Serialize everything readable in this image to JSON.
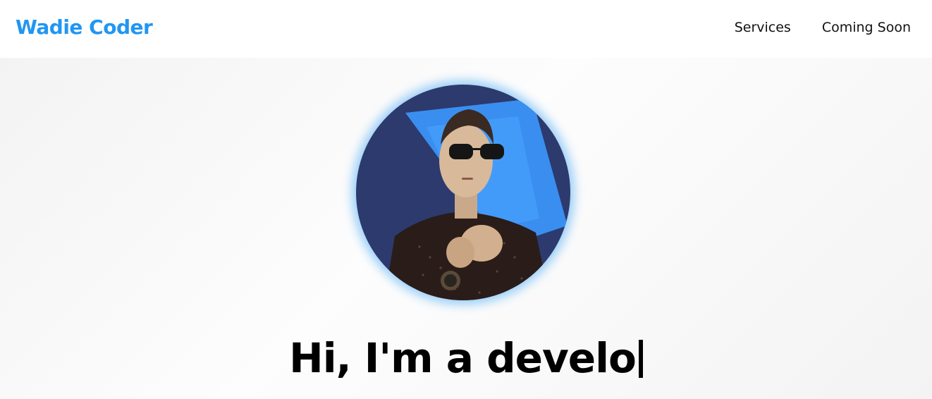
{
  "header": {
    "brand": "Wadie Coder",
    "nav": [
      {
        "label": "Services"
      },
      {
        "label": "Coming Soon"
      }
    ]
  },
  "hero": {
    "avatar_icon": "profile-photo",
    "headline": "Hi, I'm a develo"
  },
  "colors": {
    "brand": "#2196f3",
    "text": "#000000",
    "glow": "#2196f3"
  }
}
